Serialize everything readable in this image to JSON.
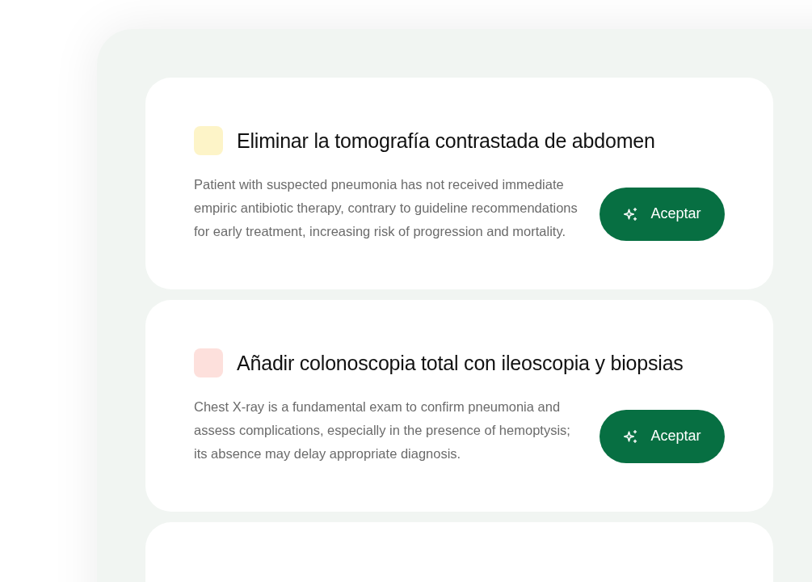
{
  "cards": [
    {
      "kind": "suggestion",
      "color": "#fdf4c8",
      "title": "Eliminar la tomografía contrastada de abdomen",
      "description": "Patient with suspected pneumonia has not received immediate empiric antibiotic therapy, contrary to guideline recommendations for early treatment, increasing risk of progression and mortality.",
      "button": "Aceptar"
    },
    {
      "kind": "suggestion",
      "color": "#fde0dc",
      "title": "Añadir colonoscopia total con ileoscopia y biopsias",
      "description": "Chest X-ray is a fundamental exam to confirm pneumonia and assess complications, especially in the presence of hemoptysis; its absence may delay appropriate diagnosis.",
      "button": "Aceptar"
    },
    {
      "kind": "cut-off"
    }
  ]
}
